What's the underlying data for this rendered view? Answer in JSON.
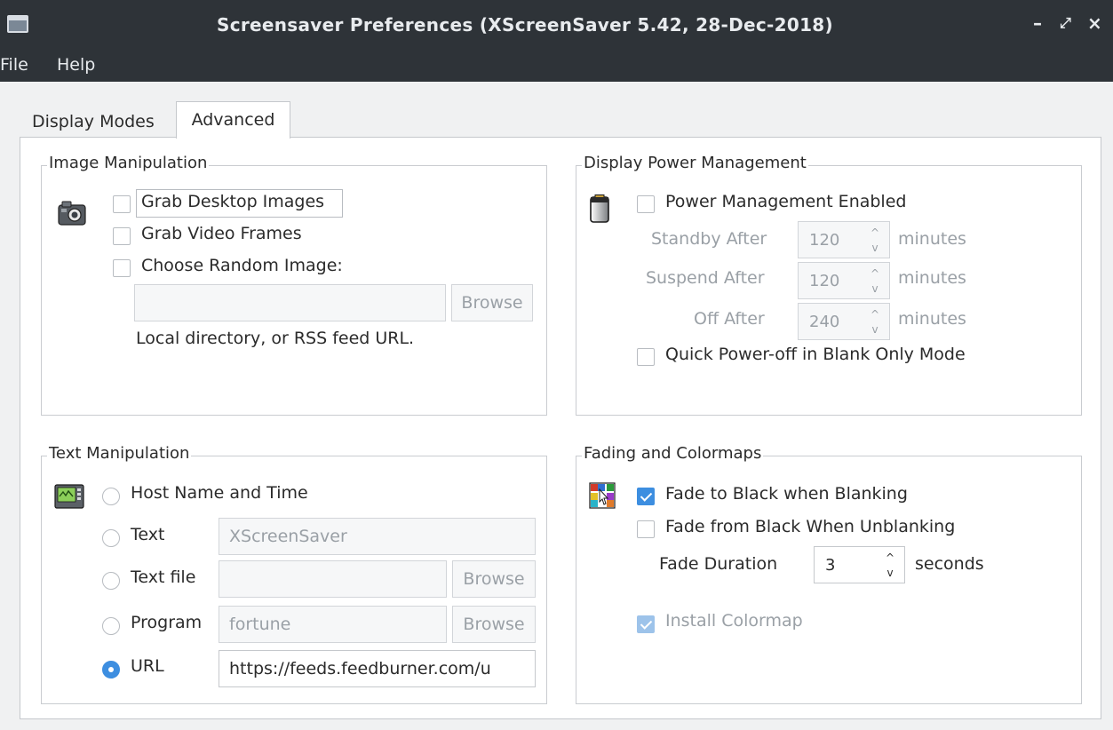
{
  "window": {
    "title": "Screensaver Preferences  (XScreenSaver 5.42, 28-Dec-2018)",
    "buttons": {
      "minimize": "–",
      "maximize": "⤢",
      "close": "×"
    }
  },
  "menu": [
    {
      "label": "File"
    },
    {
      "label": "Help"
    }
  ],
  "tabs": [
    {
      "label": "Display Modes",
      "active": false
    },
    {
      "label": "Advanced",
      "active": true
    }
  ],
  "image_manipulation": {
    "title": "Image Manipulation",
    "icon": "camera-icon",
    "grab_desktop": {
      "label": "Grab Desktop Images",
      "checked": false
    },
    "grab_video": {
      "label": "Grab Video Frames",
      "checked": false
    },
    "random_image": {
      "label": "Choose Random Image:",
      "checked": false
    },
    "path_value": "",
    "browse_label": "Browse",
    "hint": "Local directory, or RSS feed URL."
  },
  "power_management": {
    "title": "Display Power Management",
    "icon": "battery-icon",
    "enabled": {
      "label": "Power Management Enabled",
      "checked": false
    },
    "standby": {
      "label": "Standby After",
      "value": "120",
      "unit": "minutes"
    },
    "suspend": {
      "label": "Suspend After",
      "value": "120",
      "unit": "minutes"
    },
    "off": {
      "label": "Off After",
      "value": "240",
      "unit": "minutes"
    },
    "quick_off": {
      "label": "Quick Power-off in Blank Only Mode",
      "checked": false
    }
  },
  "text_manipulation": {
    "title": "Text Manipulation",
    "icon": "terminal-icon",
    "options": [
      {
        "label": "Host Name and Time",
        "selected": false
      },
      {
        "label": "Text",
        "selected": false,
        "value": "XScreenSaver"
      },
      {
        "label": "Text file",
        "selected": false,
        "value": "",
        "browse": "Browse"
      },
      {
        "label": "Program",
        "selected": false,
        "value": "fortune",
        "browse": "Browse"
      },
      {
        "label": "URL",
        "selected": true,
        "value": "https://feeds.feedburner.com/u"
      }
    ]
  },
  "fading": {
    "title": "Fading and Colormaps",
    "icon": "colormap-icon",
    "fade_to_black": {
      "label": "Fade to Black when Blanking",
      "checked": true
    },
    "fade_from_black": {
      "label": "Fade from Black When Unblanking",
      "checked": false
    },
    "duration": {
      "label": "Fade Duration",
      "value": "3",
      "unit": "seconds"
    },
    "install_colormap": {
      "label": "Install Colormap",
      "checked": true
    }
  },
  "colors": {
    "accent": "#3d8ee0",
    "titlebar": "#2e3338",
    "window_bg": "#f0f1f2"
  }
}
